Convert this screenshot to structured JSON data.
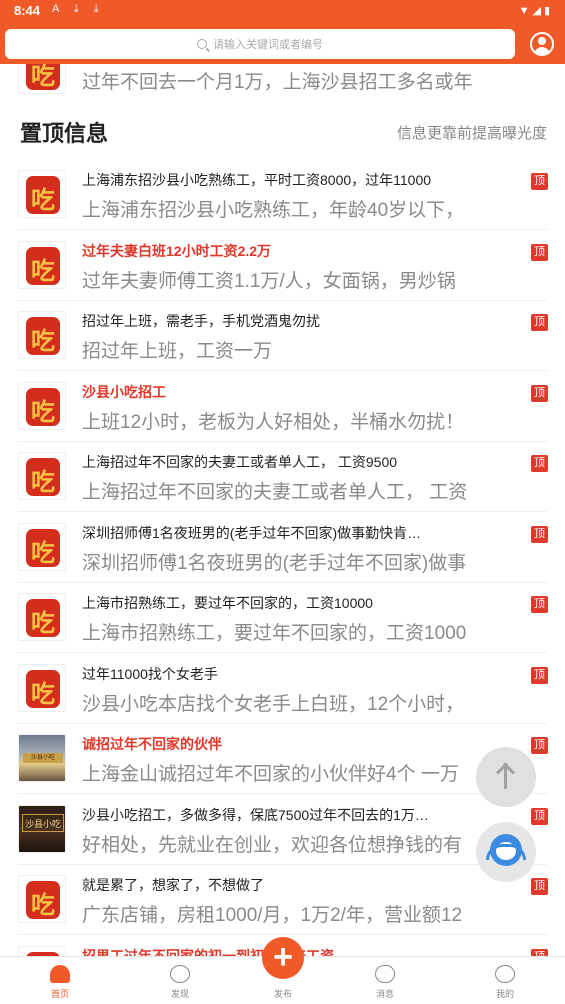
{
  "status_bar": {
    "time": "8:44",
    "notif_icons": "A ⤓ ⤓",
    "system_icons": "▼◢▮"
  },
  "search": {
    "placeholder": "请输入关键词或者编号"
  },
  "logo_char": "吃",
  "partial_item": {
    "desc": "过年不回去一个月1万，上海沙县招工多名或年"
  },
  "section": {
    "title": "置顶信息",
    "hint": "信息更靠前提高曝光度"
  },
  "badge_label": "顶",
  "listings": [
    {
      "title": "上海浦东招沙县小吃熟练工，平时工资8000，过年11000",
      "desc": "上海浦东招沙县小吃熟练工，年龄40岁以下，",
      "highlight": false,
      "thumb": "logo"
    },
    {
      "title": "过年夫妻白班12小时工资2.2万",
      "desc": "过年夫妻师傅工资1.1万/人，女面锅，男炒锅",
      "highlight": true,
      "thumb": "logo"
    },
    {
      "title": "招过年上班，需老手，手机党酒鬼勿扰",
      "desc": "招过年上班，工资一万",
      "highlight": false,
      "thumb": "logo"
    },
    {
      "title": "沙县小吃招工",
      "desc": "上班12小时，老板为人好相处，半桶水勿扰！",
      "highlight": true,
      "thumb": "logo"
    },
    {
      "title": "上海招过年不回家的夫妻工或者单人工， 工资9500",
      "desc": "上海招过年不回家的夫妻工或者单人工， 工资",
      "highlight": false,
      "thumb": "logo"
    },
    {
      "title": "深圳招师傅1名夜班男的(老手过年不回家)做事勤快肯…",
      "desc": "深圳招师傅1名夜班男的(老手过年不回家)做事",
      "highlight": false,
      "thumb": "logo"
    },
    {
      "title": "上海市招熟练工，要过年不回家的，工资10000",
      "desc": "上海市招熟练工，要过年不回家的，工资1000",
      "highlight": false,
      "thumb": "logo"
    },
    {
      "title": "过年11000找个女老手",
      "desc": "沙县小吃本店找个女老手上白班，12个小时，",
      "highlight": false,
      "thumb": "logo"
    },
    {
      "title": "诚招过年不回家的伙伴",
      "desc": "上海金山诚招过年不回家的小伙伴好4个 一万",
      "highlight": true,
      "thumb": "photo1"
    },
    {
      "title": "沙县小吃招工，多做多得，保底7500过年不回去的1万…",
      "desc": "好相处，先就业在创业，欢迎各位想挣钱的有",
      "highlight": false,
      "thumb": "photo2"
    },
    {
      "title": "就是累了，想家了，不想做了",
      "desc": "广东店铺，房租1000/月，1万2/年，营业额12",
      "highlight": false,
      "thumb": "logo"
    },
    {
      "title": "招男工过年不回家的初一到初五双倍工资",
      "desc": "",
      "highlight": true,
      "thumb": "logo"
    }
  ],
  "photo1_sign": "沙县小吃",
  "photo2_sign": "沙县小吃",
  "nav": {
    "home": "首页",
    "discover": "发现",
    "publish": "发布",
    "publish_symbol": "+",
    "messages": "消息",
    "mine": "我的"
  },
  "colors": {
    "brand": "#f05a28",
    "badge": "#e0392b",
    "highlight_text": "#e0392b"
  }
}
